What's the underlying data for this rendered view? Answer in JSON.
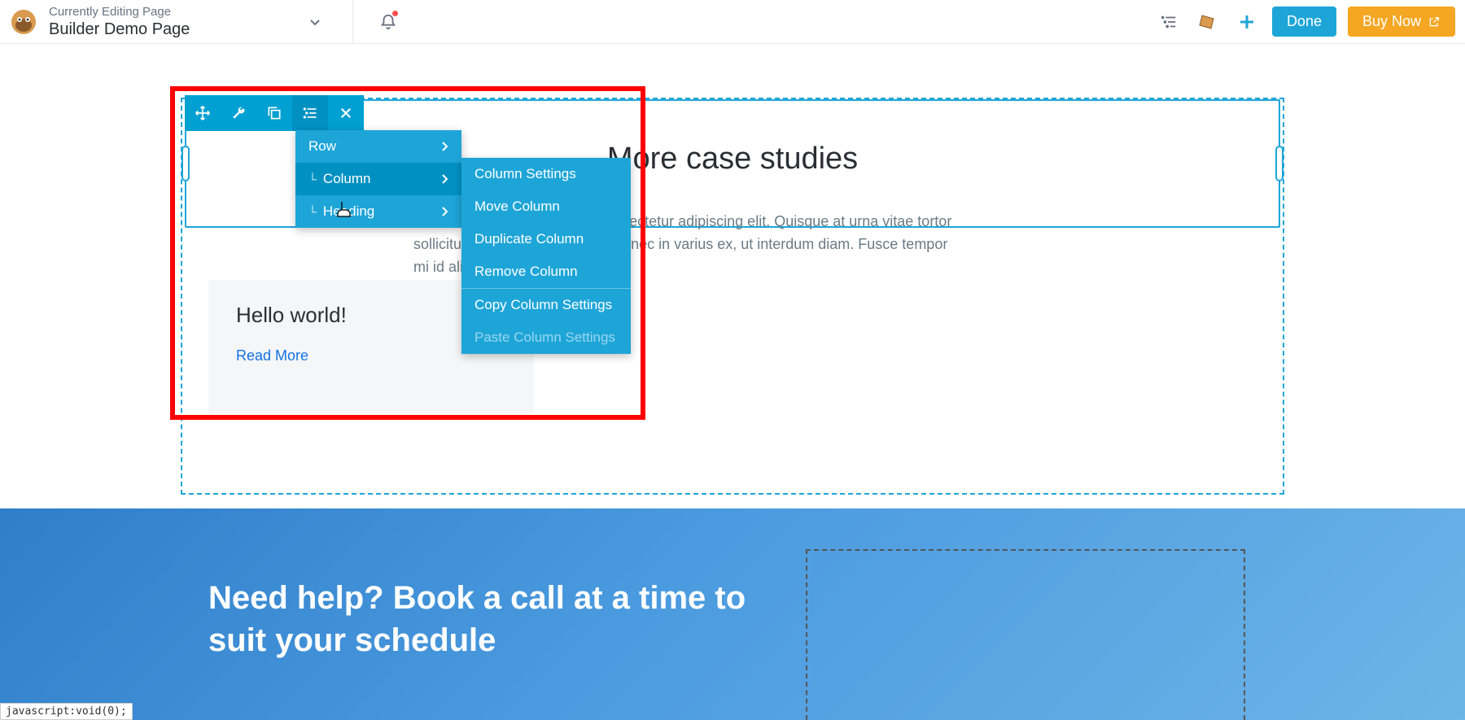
{
  "topbar": {
    "editing_label": "Currently Editing Page",
    "page_title": "Builder Demo Page",
    "done_label": "Done",
    "buy_label": "Buy Now"
  },
  "toolbar": {
    "items": [
      "move",
      "wrench",
      "duplicate",
      "outline",
      "close"
    ]
  },
  "menu1": {
    "items": [
      {
        "label": "Row",
        "indent": 0
      },
      {
        "label": "Column",
        "indent": 1
      },
      {
        "label": "Heading",
        "indent": 1
      }
    ]
  },
  "menu2": {
    "items": [
      {
        "label": "Column Settings"
      },
      {
        "label": "Move Column"
      },
      {
        "label": "Duplicate Column"
      },
      {
        "label": "Remove Column"
      },
      {
        "sep": true
      },
      {
        "label": "Copy Column Settings"
      },
      {
        "label": "Paste Column Settings",
        "disabled": true
      }
    ]
  },
  "content": {
    "heading": "More case studies",
    "lorem": "Lorem ipsum dolor sit amet, consectetur adipiscing elit. Quisque at urna vitae tortor sollicitudin sodales at eu nibh. Donec in varius ex, ut interdum diam. Fusce tempor mi id aliquet rutrum.",
    "card_title": "Hello world!",
    "card_link": "Read More"
  },
  "blue": {
    "heading": "Need help? Book a call at a time to suit your schedule"
  },
  "status": "javascript:void(0);"
}
